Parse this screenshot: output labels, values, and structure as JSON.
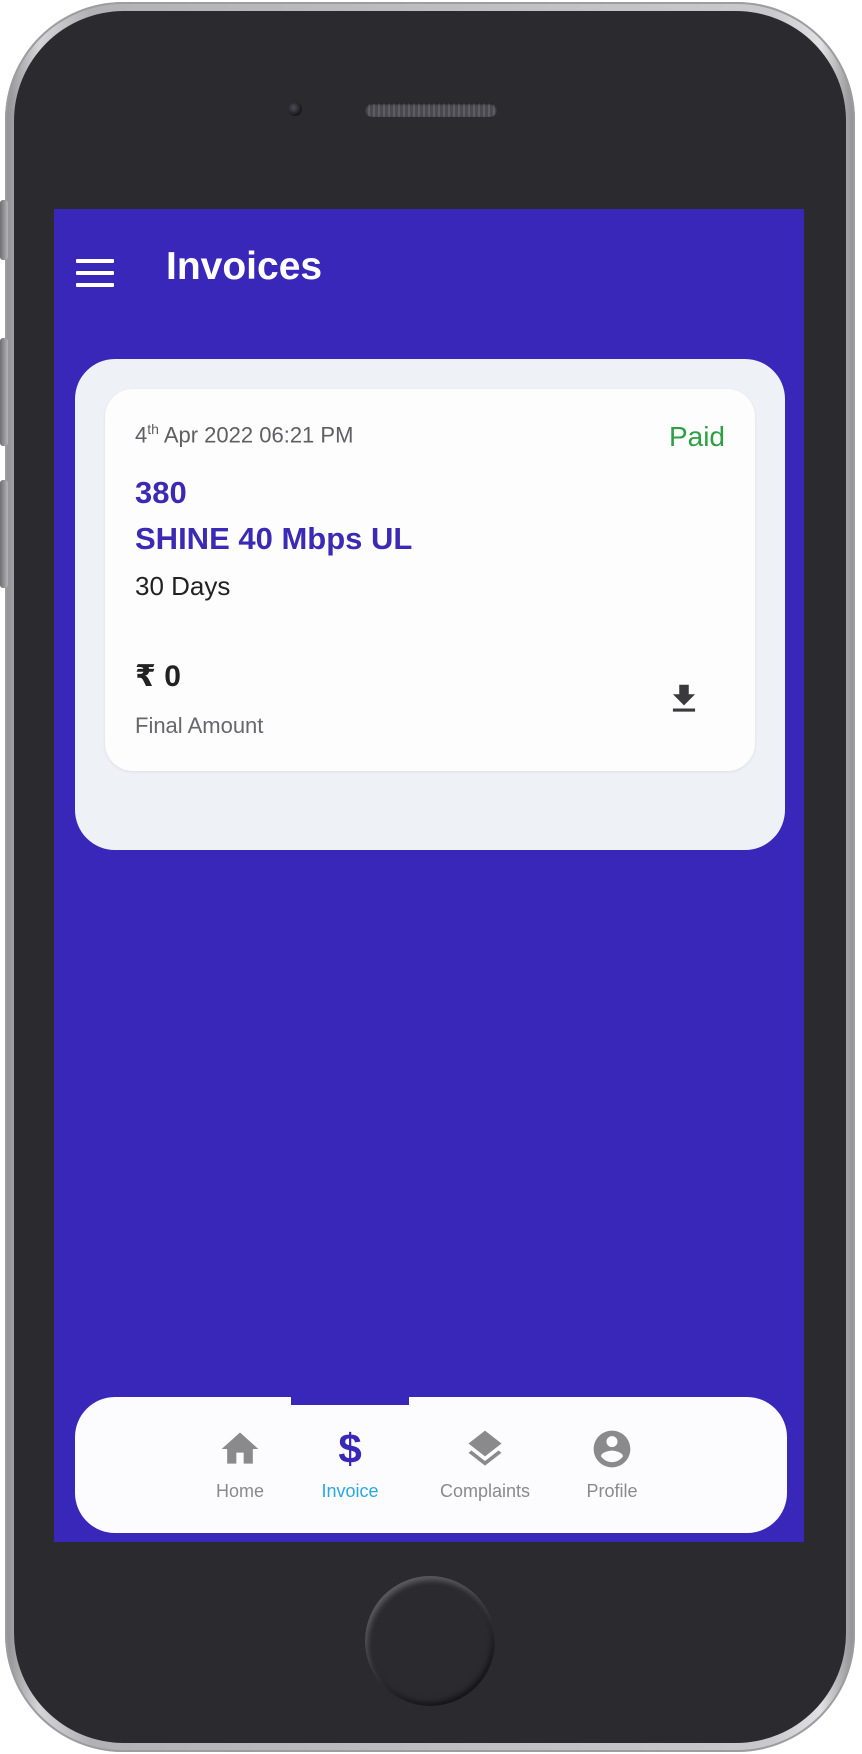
{
  "header": {
    "title": "Invoices"
  },
  "invoice": {
    "date_day": "4",
    "date_suffix": "th",
    "date_rest": " Apr 2022 06:21 PM",
    "status": "Paid",
    "id": "380",
    "plan": "SHINE 40 Mbps UL",
    "duration": "30 Days",
    "amount": "₹ 0",
    "amount_label": "Final Amount"
  },
  "nav": {
    "items": [
      {
        "label": "Home",
        "icon": "home-icon",
        "active": false
      },
      {
        "label": "Invoice",
        "icon": "dollar-icon",
        "active": true
      },
      {
        "label": "Complaints",
        "icon": "layers-icon",
        "active": false
      },
      {
        "label": "Profile",
        "icon": "account-circle-icon",
        "active": false
      }
    ]
  },
  "colors": {
    "primary": "#3827b8",
    "status_paid": "#2ea043",
    "nav_active_label": "#2aa6e6",
    "nav_inactive": "#8a8a8d",
    "panel_background": "#eef2f6"
  }
}
